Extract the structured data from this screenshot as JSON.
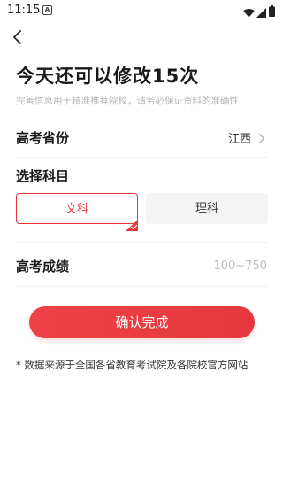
{
  "status_bar": {
    "time": "11:15",
    "notification_icon": "A"
  },
  "header": {
    "back_icon": "chevron-left-icon"
  },
  "page": {
    "title": "今天还可以修改15次",
    "subtitle": "完善信息用于精准推荐院校，请务必保证资料的准确性"
  },
  "province": {
    "label": "高考省份",
    "value": "江西"
  },
  "subject": {
    "label": "选择科目",
    "options": [
      "文科",
      "理科"
    ],
    "selected": "文科"
  },
  "score": {
    "label": "高考成绩",
    "placeholder": "100~750",
    "value": ""
  },
  "confirm": {
    "label": "确认完成"
  },
  "footnote": "* 数据来源于全国各省教育考试院及各院校官方网站",
  "colors": {
    "accent": "#e8353b",
    "muted_text": "#b4b4b4",
    "unselected_bg": "#f4f4f4"
  }
}
